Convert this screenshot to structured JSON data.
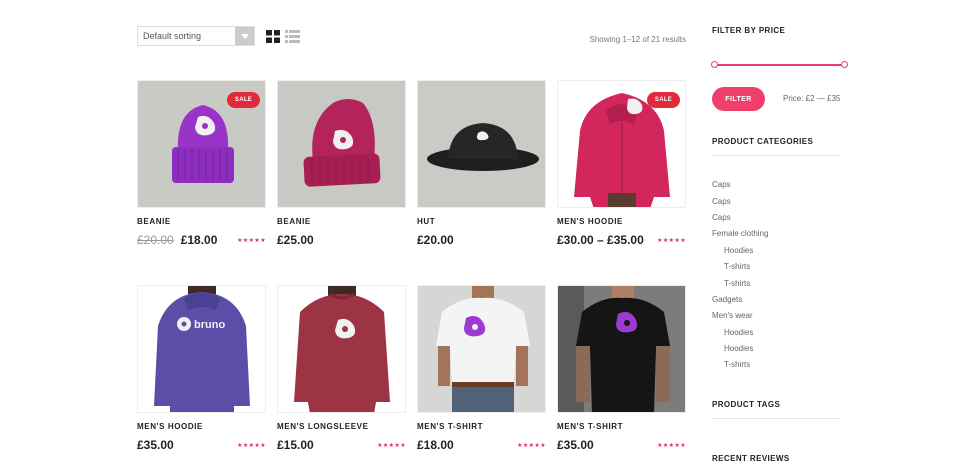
{
  "toolbar": {
    "sort_value": "Default sorting",
    "result_count": "Showing 1–12 of 21 results"
  },
  "products": [
    {
      "name": "BEANIE",
      "old_price": "£20.00",
      "price": "£18.00",
      "sale_badge": "SALE",
      "rating": 5
    },
    {
      "name": "BEANIE",
      "price": "£25.00",
      "rating": 0
    },
    {
      "name": "HUT",
      "price": "£20.00",
      "rating": 0
    },
    {
      "name": "MEN'S HOODIE",
      "price": "£30.00 – £35.00",
      "sale_badge": "SALE",
      "rating": 5
    },
    {
      "name": "MEN'S HOODIE",
      "price": "£35.00",
      "rating": 5
    },
    {
      "name": "MEN'S LONGSLEEVE",
      "price": "£15.00",
      "rating": 5
    },
    {
      "name": "MEN'S T-SHIRT",
      "price": "£18.00",
      "rating": 5
    },
    {
      "name": "MEN'S T-SHIRT",
      "price": "£35.00",
      "rating": 5
    }
  ],
  "product_image_text": {
    "hoodie_print": "bruno"
  },
  "sidebar": {
    "filter_title": "FILTER BY PRICE",
    "filter_button": "FILTER",
    "price_range": "Price: £2 — £35",
    "categories_title": "PRODUCT CATEGORIES",
    "categories": [
      {
        "label": "Caps",
        "sub": false
      },
      {
        "label": "Caps",
        "sub": false
      },
      {
        "label": "Caps",
        "sub": false
      },
      {
        "label": "Female clothing",
        "sub": false
      },
      {
        "label": "Hoodies",
        "sub": true
      },
      {
        "label": "T-shirts",
        "sub": true
      },
      {
        "label": "T-shirts",
        "sub": true
      },
      {
        "label": "Gadgets",
        "sub": false
      },
      {
        "label": "Men's wear",
        "sub": false
      },
      {
        "label": "Hoodies",
        "sub": true
      },
      {
        "label": "Hoodies",
        "sub": true
      },
      {
        "label": "T-shirts",
        "sub": true
      }
    ],
    "tags_title": "PRODUCT TAGS",
    "reviews_title": "RECENT REVIEWS"
  },
  "icons": {
    "sort_arrow": "chevron-down-icon",
    "grid_view": "grid-icon",
    "list_view": "list-icon",
    "star": "star-icon"
  },
  "colors": {
    "accent": "#ef3f6a",
    "sale": "#e12b3c",
    "star": "#e12b5a"
  }
}
